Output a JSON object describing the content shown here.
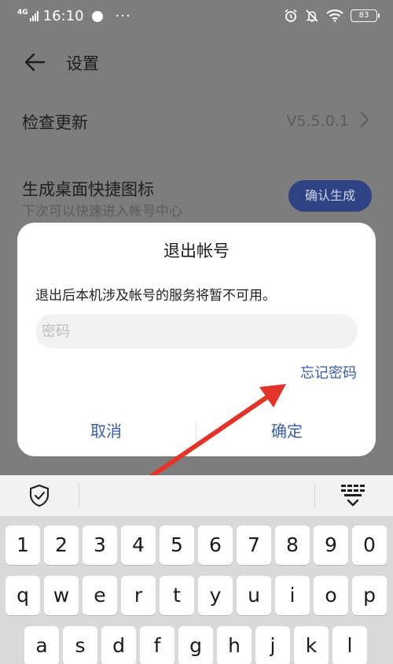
{
  "status_bar": {
    "network": "4G",
    "time": "16:10",
    "more": "···",
    "battery": "83"
  },
  "app_bar": {
    "title": "设置"
  },
  "settings": {
    "check_update": {
      "label": "检查更新",
      "value": "V5.5.0.1"
    },
    "shortcut": {
      "label": "生成桌面快捷图标",
      "sub": "下次可以快速进入帐号中心",
      "button": "确认生成"
    }
  },
  "dialog": {
    "title": "退出帐号",
    "message": "退出后本机涉及帐号的服务将暂不可用。",
    "password_placeholder": "密码",
    "forgot_password": "忘记密码",
    "cancel": "取消",
    "confirm": "确定"
  },
  "keyboard": {
    "row1": [
      "1",
      "2",
      "3",
      "4",
      "5",
      "6",
      "7",
      "8",
      "9",
      "0"
    ],
    "row2": [
      "q",
      "w",
      "e",
      "r",
      "t",
      "y",
      "u",
      "i",
      "o",
      "p"
    ],
    "row3": [
      "a",
      "s",
      "d",
      "f",
      "g",
      "h",
      "j",
      "k",
      "l"
    ]
  },
  "colors": {
    "accent": "#3a5ea8",
    "annotation_arrow": "#e3342a",
    "dim_overlay": "#7d7d7d"
  }
}
